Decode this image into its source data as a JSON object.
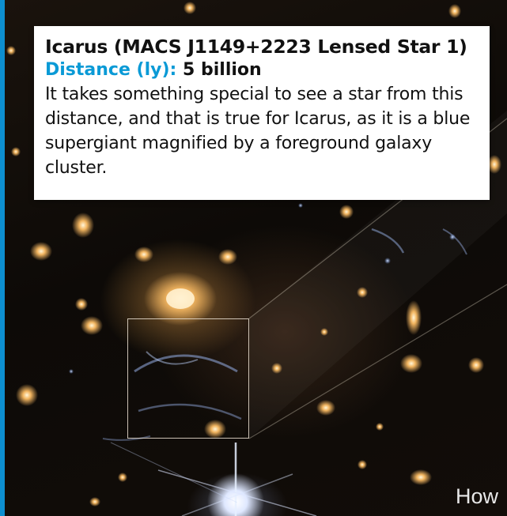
{
  "caption": {
    "title": "Icarus (MACS J1149+2223 Lensed Star 1)",
    "distance_label": "Distance (ly):",
    "distance_value": "5 billion",
    "body": "It takes something special to see a star from this distance, and that is true for Icarus, as it is a blue supergiant magnified by a foreground galaxy cluster."
  },
  "footer": {
    "partial_text": "How"
  },
  "colors": {
    "accent_blue": "#0a9ad6",
    "edge_bar": "#0d8fd0",
    "text": "#111111"
  }
}
